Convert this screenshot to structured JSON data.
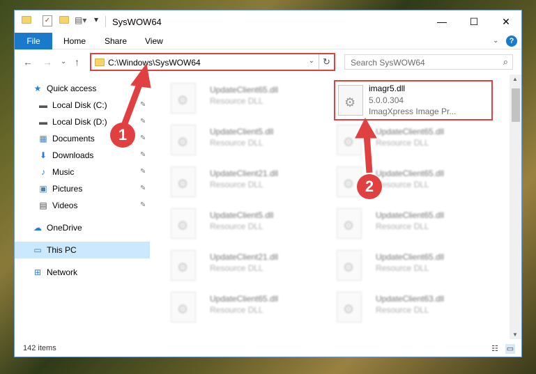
{
  "window": {
    "title": "SysWOW64",
    "controls": {
      "minimize": "—",
      "maximize": "☐",
      "close": "✕"
    }
  },
  "ribbon": {
    "tabs": [
      "File",
      "Home",
      "Share",
      "View"
    ],
    "help": "?"
  },
  "address": {
    "path": "C:\\Windows\\SysWOW64",
    "refresh": "↻",
    "dropdown": "⌄"
  },
  "search": {
    "placeholder": "Search SysWOW64",
    "icon": "search-icon"
  },
  "nav_pane": {
    "items": [
      {
        "label": "Quick access",
        "icon": "star-icon"
      },
      {
        "label": "Local Disk (C:)",
        "icon": "drive-icon",
        "pinned": true
      },
      {
        "label": "Local Disk (D:)",
        "icon": "drive-icon",
        "pinned": true
      },
      {
        "label": "Documents",
        "icon": "documents-icon",
        "pinned": true
      },
      {
        "label": "Downloads",
        "icon": "download-icon",
        "pinned": true
      },
      {
        "label": "Music",
        "icon": "music-icon",
        "pinned": true
      },
      {
        "label": "Pictures",
        "icon": "pictures-icon",
        "pinned": true
      },
      {
        "label": "Videos",
        "icon": "videos-icon",
        "pinned": true
      },
      {
        "label": "OneDrive",
        "icon": "cloud-icon"
      },
      {
        "label": "This PC",
        "icon": "pc-icon",
        "selected": true
      },
      {
        "label": "Network",
        "icon": "network-icon"
      }
    ]
  },
  "files": {
    "highlighted": {
      "name": "imagr5.dll",
      "version": "5.0.0.304",
      "description": "ImagXpress Image Pr..."
    },
    "left_column": [
      {
        "name": "UpdateClient65.dll",
        "type": "Resource DLL"
      },
      {
        "name": "UpdateClient5.dll",
        "type": "Resource DLL"
      },
      {
        "name": "UpdateClient21.dll",
        "type": "Resource DLL"
      },
      {
        "name": "UpdateClient5.dll",
        "type": "Resource DLL"
      },
      {
        "name": "UpdateClient21.dll",
        "type": "Resource DLL"
      },
      {
        "name": "UpdateClient65.dll",
        "type": "Resource DLL"
      }
    ],
    "right_column": [
      {
        "name": "UpdateClient65.dll",
        "type": "Resource DLL"
      },
      {
        "name": "UpdateClient65.dll",
        "type": "Resource DLL"
      },
      {
        "name": "UpdateClient65.dll",
        "type": "Resource DLL"
      },
      {
        "name": "UpdateClient65.dll",
        "type": "Resource DLL"
      },
      {
        "name": "UpdateClient63.dll",
        "type": "Resource DLL"
      }
    ]
  },
  "status": {
    "item_count": "142 items"
  },
  "annotations": {
    "step1": "1",
    "step2": "2",
    "color": "#e04040"
  }
}
